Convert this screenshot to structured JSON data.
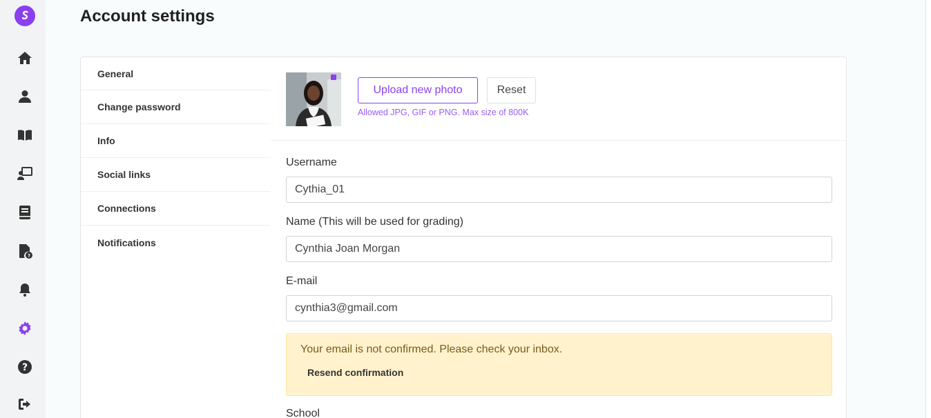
{
  "app": {
    "brand_color": "#8a3ff0"
  },
  "sidebar": {
    "items": [
      {
        "icon": "home-icon"
      },
      {
        "icon": "user-icon"
      },
      {
        "icon": "book-open-icon"
      },
      {
        "icon": "teacher-icon"
      },
      {
        "icon": "notebook-icon"
      },
      {
        "icon": "file-question-icon"
      },
      {
        "icon": "bell-icon"
      },
      {
        "icon": "gear-icon",
        "active": true
      },
      {
        "icon": "help-icon"
      },
      {
        "icon": "logout-icon"
      }
    ]
  },
  "page": {
    "title": "Account settings"
  },
  "tabs": [
    "General",
    "Change password",
    "Info",
    "Social links",
    "Connections",
    "Notifications"
  ],
  "photo": {
    "upload_label": "Upload new photo",
    "reset_label": "Reset",
    "hint": "Allowed JPG, GIF or PNG. Max size of 800K"
  },
  "form": {
    "username": {
      "label": "Username",
      "value": "Cythia_01"
    },
    "name": {
      "label": "Name (This will be used for grading)",
      "value": "Cynthia Joan Morgan"
    },
    "email": {
      "label": "E-mail",
      "value": "cynthia3@gmail.com"
    },
    "school": {
      "label": "School"
    }
  },
  "alert": {
    "message": "Your email is not confirmed. Please check your inbox.",
    "action": "Resend confirmation"
  }
}
